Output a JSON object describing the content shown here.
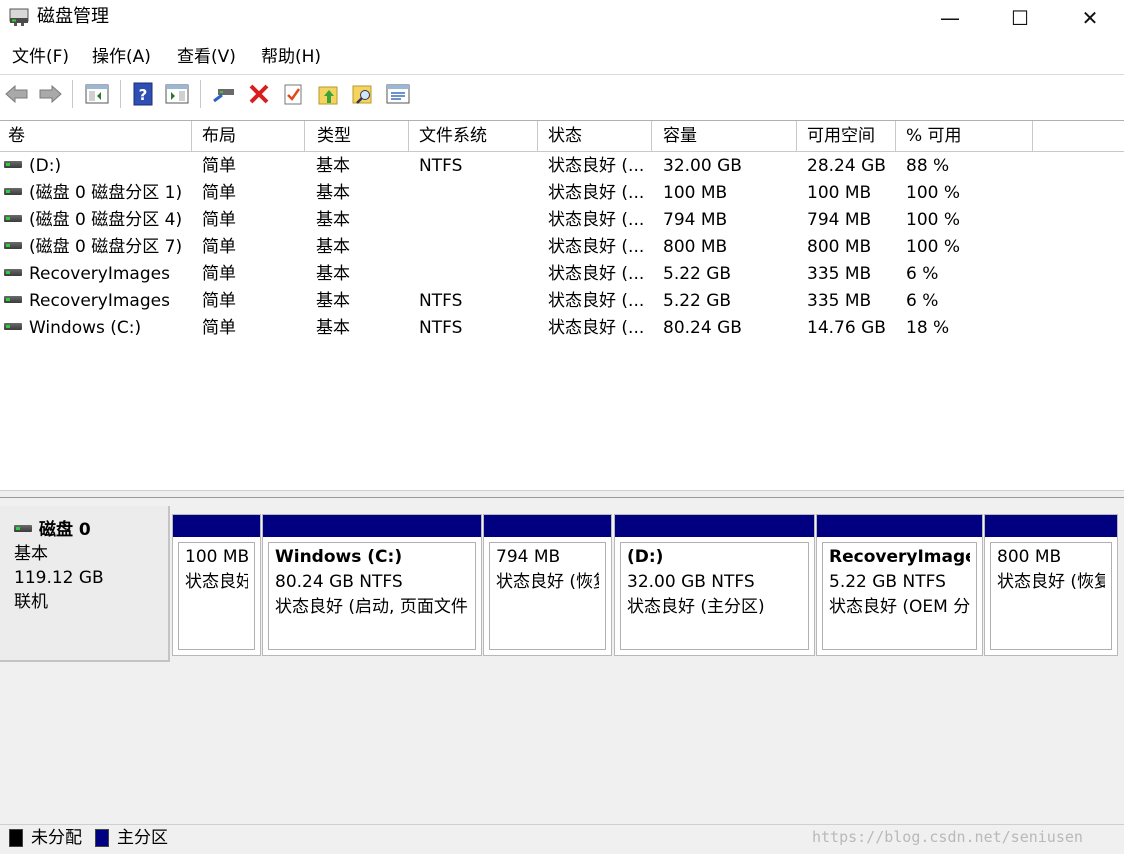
{
  "window": {
    "title": "磁盘管理",
    "minimize": "—",
    "maximize": "☐",
    "close": "✕"
  },
  "menu": [
    {
      "label": "文件(F)"
    },
    {
      "label": "操作(A)"
    },
    {
      "label": "查看(V)"
    },
    {
      "label": "帮助(H)"
    }
  ],
  "toolbar": {
    "icons": [
      "back-arrow-icon",
      "forward-arrow-icon",
      "console-tree-icon",
      "help-icon",
      "action-pane-icon",
      "connect-disk-icon",
      "delete-icon",
      "check-properties-icon",
      "folder-up-icon",
      "folder-search-icon",
      "list-view-icon"
    ]
  },
  "volume_list": {
    "columns": [
      "卷",
      "布局",
      "类型",
      "文件系统",
      "状态",
      "容量",
      "可用空间",
      "% 可用"
    ],
    "rows": [
      {
        "volume": "(D:)",
        "layout": "简单",
        "type": "基本",
        "fs": "NTFS",
        "status": "状态良好 (...",
        "capacity": "32.00 GB",
        "free": "28.24 GB",
        "pct": "88 %"
      },
      {
        "volume": "(磁盘 0 磁盘分区 1)",
        "layout": "简单",
        "type": "基本",
        "fs": "",
        "status": "状态良好 (...",
        "capacity": "100 MB",
        "free": "100 MB",
        "pct": "100 %"
      },
      {
        "volume": "(磁盘 0 磁盘分区 4)",
        "layout": "简单",
        "type": "基本",
        "fs": "",
        "status": "状态良好 (...",
        "capacity": "794 MB",
        "free": "794 MB",
        "pct": "100 %"
      },
      {
        "volume": "(磁盘 0 磁盘分区 7)",
        "layout": "简单",
        "type": "基本",
        "fs": "",
        "status": "状态良好 (...",
        "capacity": "800 MB",
        "free": "800 MB",
        "pct": "100 %"
      },
      {
        "volume": "RecoveryImages",
        "layout": "简单",
        "type": "基本",
        "fs": "",
        "status": "状态良好 (...",
        "capacity": "5.22 GB",
        "free": "335 MB",
        "pct": "6 %"
      },
      {
        "volume": "RecoveryImages",
        "layout": "简单",
        "type": "基本",
        "fs": "NTFS",
        "status": "状态良好 (...",
        "capacity": "5.22 GB",
        "free": "335 MB",
        "pct": "6 %"
      },
      {
        "volume": "Windows (C:)",
        "layout": "简单",
        "type": "基本",
        "fs": "NTFS",
        "status": "状态良好 (...",
        "capacity": "80.24 GB",
        "free": "14.76 GB",
        "pct": "18 %"
      }
    ]
  },
  "disk": {
    "name": "磁盘 0",
    "type": "基本",
    "size": "119.12 GB",
    "state": "联机",
    "partitions": [
      {
        "name": "",
        "size": "100 MB",
        "status": "状态良好"
      },
      {
        "name": "Windows  (C:)",
        "size": "80.24 GB NTFS",
        "status": "状态良好 (启动, 页面文件"
      },
      {
        "name": "",
        "size": "794 MB",
        "status": "状态良好 (恢复"
      },
      {
        "name": " (D:)",
        "size": "32.00 GB NTFS",
        "status": "状态良好 (主分区)"
      },
      {
        "name": "RecoveryImages",
        "size": "5.22 GB NTFS",
        "status": "状态良好 (OEM 分"
      },
      {
        "name": "",
        "size": "800 MB",
        "status": "状态良好 (恢复"
      }
    ]
  },
  "legend": [
    {
      "label": "未分配",
      "color": "#000000"
    },
    {
      "label": "主分区",
      "color": "#000080"
    }
  ],
  "watermark": "https://blog.csdn.net/seniusen"
}
